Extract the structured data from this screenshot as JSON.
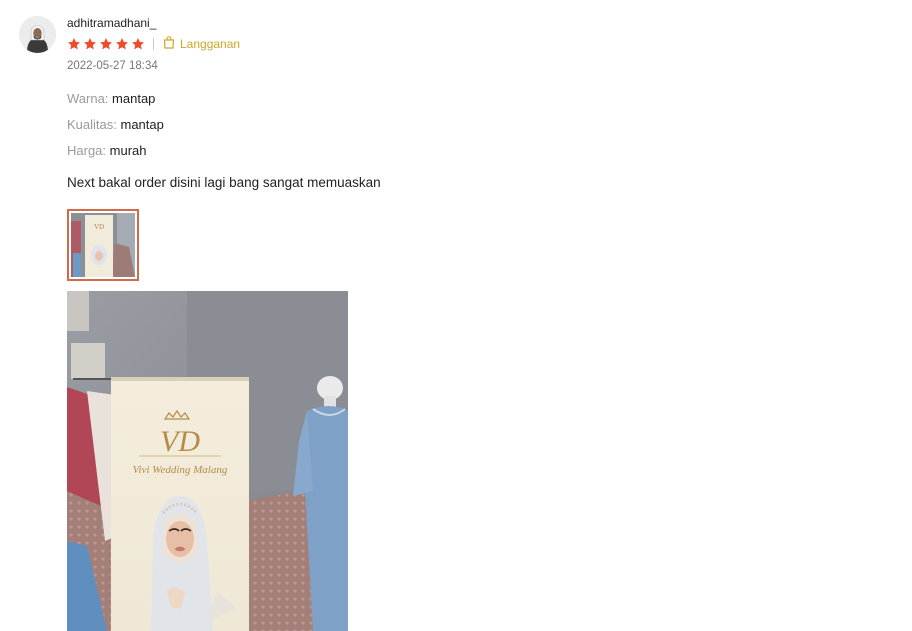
{
  "review": {
    "username": "adhitramadhani_",
    "rating": 5,
    "badge_label": "Langganan",
    "timestamp": "2022-05-27 18:34",
    "attributes": [
      {
        "key": "Warna:",
        "value": "mantap"
      },
      {
        "key": "Kualitas:",
        "value": "mantap"
      },
      {
        "key": "Harga:",
        "value": "murah"
      }
    ],
    "comment": "Next bakal order disini lagi bang sangat memuaskan",
    "star_color": "#ee4d2d",
    "badge_color": "#d0a52a",
    "thumb_border_color": "#d36b4a",
    "banner": {
      "monogram": "VD",
      "brand": "Vivi Wedding Malang"
    }
  }
}
